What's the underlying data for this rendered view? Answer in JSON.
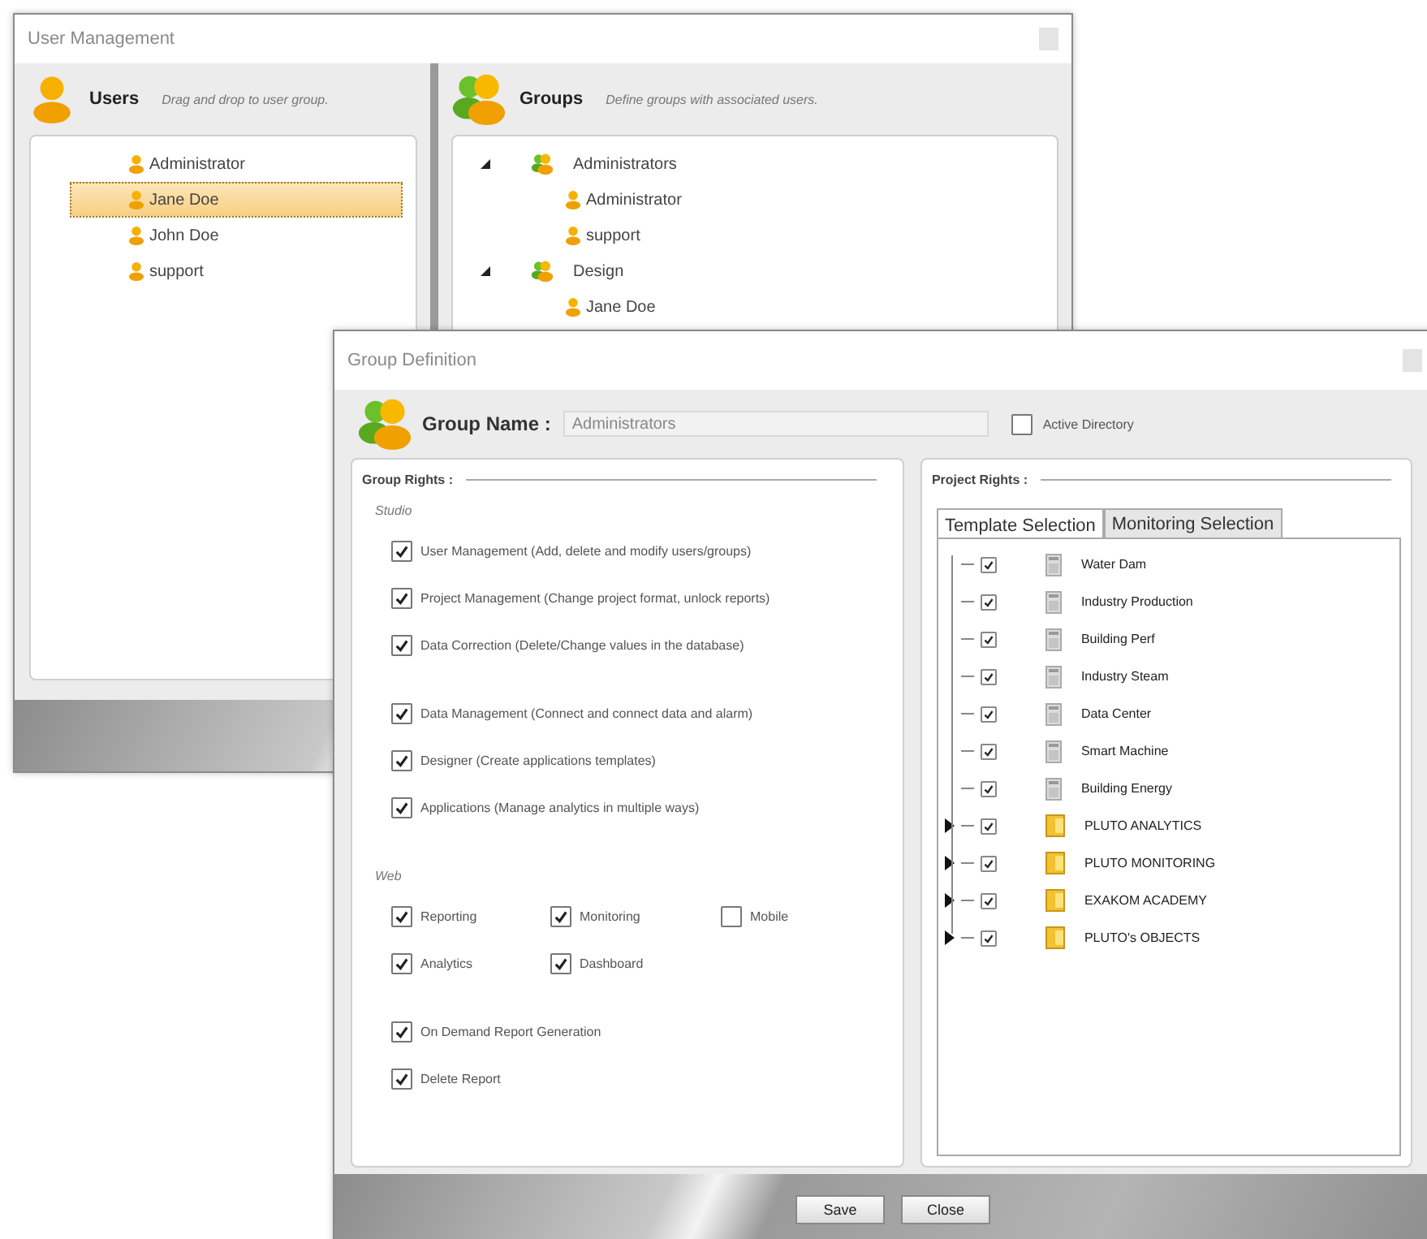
{
  "user_management": {
    "title": "User Management",
    "users": {
      "title": "Users",
      "hint": "Drag and drop to user group.",
      "items": [
        {
          "name": "Administrator",
          "selected": false
        },
        {
          "name": "Jane Doe",
          "selected": true
        },
        {
          "name": "John Doe",
          "selected": false
        },
        {
          "name": "support",
          "selected": false
        }
      ]
    },
    "groups": {
      "title": "Groups",
      "hint": "Define groups with associated users.",
      "tree": [
        {
          "name": "Administrators",
          "expanded": true,
          "children": [
            {
              "name": "Administrator"
            },
            {
              "name": "support"
            }
          ]
        },
        {
          "name": "Design",
          "expanded": true,
          "children": [
            {
              "name": "Jane Doe"
            }
          ]
        }
      ]
    }
  },
  "group_definition": {
    "title": "Group Definition",
    "group_name_label": "Group Name :",
    "group_name_value": "Administrators",
    "active_directory": {
      "label": "Active Directory",
      "checked": false
    },
    "group_rights": {
      "title": "Group Rights :",
      "sections": [
        {
          "title": "Studio",
          "blocks": [
            [
              [
                {
                  "label": "User Management (Add, delete and modify users/groups)",
                  "checked": true
                }
              ],
              [
                {
                  "label": "Project Management (Change project format, unlock reports)",
                  "checked": true
                }
              ],
              [
                {
                  "label": "Data Correction (Delete/Change values in the database)",
                  "checked": true
                }
              ]
            ],
            [
              [
                {
                  "label": "Data Management (Connect and connect data and alarm)",
                  "checked": true
                }
              ],
              [
                {
                  "label": "Designer (Create applications templates)",
                  "checked": true
                }
              ],
              [
                {
                  "label": "Applications (Manage analytics in multiple ways)",
                  "checked": true
                }
              ]
            ]
          ]
        },
        {
          "title": "Web",
          "blocks": [
            [
              [
                {
                  "label": "Reporting",
                  "checked": true
                },
                {
                  "label": "Monitoring",
                  "checked": true
                },
                {
                  "label": "Mobile",
                  "checked": false
                }
              ],
              [
                {
                  "label": "Analytics",
                  "checked": true
                },
                {
                  "label": "Dashboard",
                  "checked": true
                }
              ]
            ],
            [
              [
                {
                  "label": "On Demand Report Generation",
                  "checked": true
                }
              ],
              [
                {
                  "label": "Delete Report",
                  "checked": true
                }
              ]
            ]
          ]
        }
      ]
    },
    "project_rights": {
      "title": "Project Rights :",
      "tabs": [
        {
          "label": "Template Selection",
          "selected": true
        },
        {
          "label": "Monitoring Selection",
          "selected": false
        }
      ],
      "items": [
        {
          "name": "Water Dam",
          "kind": "template",
          "checked": true
        },
        {
          "name": "Industry Production",
          "kind": "template",
          "checked": true
        },
        {
          "name": "Building Perf",
          "kind": "template",
          "checked": true
        },
        {
          "name": "Industry Steam",
          "kind": "template",
          "checked": true
        },
        {
          "name": "Data Center",
          "kind": "template",
          "checked": true
        },
        {
          "name": "Smart Machine",
          "kind": "template",
          "checked": true
        },
        {
          "name": "Building Energy",
          "kind": "template",
          "checked": true
        },
        {
          "name": "PLUTO ANALYTICS",
          "kind": "folder",
          "checked": true,
          "expanded": false
        },
        {
          "name": "PLUTO MONITORING",
          "kind": "folder",
          "checked": true,
          "expanded": false
        },
        {
          "name": "EXAKOM ACADEMY",
          "kind": "folder",
          "checked": true,
          "expanded": false
        },
        {
          "name": "PLUTO's OBJECTS",
          "kind": "folder",
          "checked": true,
          "expanded": false
        }
      ]
    },
    "buttons": [
      "Save",
      "Close"
    ]
  }
}
